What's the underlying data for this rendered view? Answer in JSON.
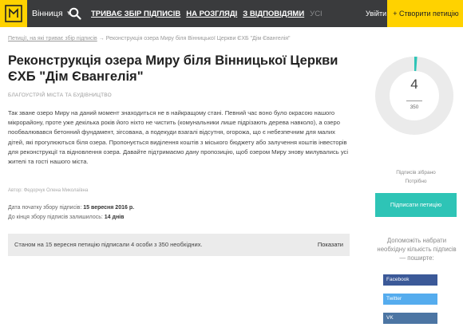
{
  "header": {
    "city": "Вінниця",
    "tabs": [
      {
        "label": "ТРИВАЄ ЗБІР ПІДПИСІВ"
      },
      {
        "label": "НА РОЗГЛЯДІ"
      },
      {
        "label": "З ВІДПОВІДЯМИ"
      },
      {
        "label": "УСІ"
      }
    ],
    "login": "Увійти",
    "create_button": "+ Створити петицію"
  },
  "breadcrumb": {
    "parent": "Петиції, на які триває збір підписів",
    "current": "Реконструкція озера Миру біля Вінницької Церкви ЄХБ \"Дім Євангелія\""
  },
  "petition": {
    "title": "Реконструкція озера Миру біля Вінницької Церкви ЄХБ \"Дім Євангелія\"",
    "category": "БЛАГОУСТРІЙ МІСТА ТА БУДІВНИЦТВО",
    "description": "Так зване озеро Миру на даний момент знаходиться не в найкращому стані. Певний час воно було окрасою нашого мікрорайону, проте уже декілька років його ніхто не чистить (комунальники лише підрізають дерева навколо), а озеро пообвалювався бетонний фундамент, зігсована, а подекуди взагалі відсутня, огорожа, що є небезпечним для малих дітей, які прогулюються біля озера. Пропонується виділення коштів з міського бюджету або залучення коштів інвесторів для реконструкції та відновлення озера. Давайте підтримаємо дану пропозицію, щоб озером Миру знову милувались усі жителі та гості нашого міста.",
    "author": "Автор: Федорчук Олена Миколаївна",
    "start_label": "Дата початку збору підписів:",
    "start_value": "15 вересня 2016 р.",
    "end_label": "До кінця збору підписів залишилось:",
    "end_value": "14 днів",
    "status_text": "Станом на 15 вересня петицію підписали 4 особи з 350 необхідних.",
    "show_link": "Показати"
  },
  "signatures": {
    "count": "4",
    "target": "350",
    "collected_label": "Підписів зібрано",
    "needed_label": "Потрібно",
    "progress_fraction": 0.0114
  },
  "sidebar": {
    "sign_button": "Підписати петицію",
    "help_text": "Допоможіть набрати необхідну кількість підписів — поширте:",
    "share": [
      {
        "label": "Facebook"
      },
      {
        "label": "Twitter"
      },
      {
        "label": "VK"
      }
    ]
  },
  "colors": {
    "header_bg": "#3a3b3d",
    "accent_yellow": "#ffd200",
    "accent_teal": "#2ec4b6",
    "facebook": "#3b5998",
    "twitter": "#55acee",
    "vk": "#4c75a3"
  }
}
